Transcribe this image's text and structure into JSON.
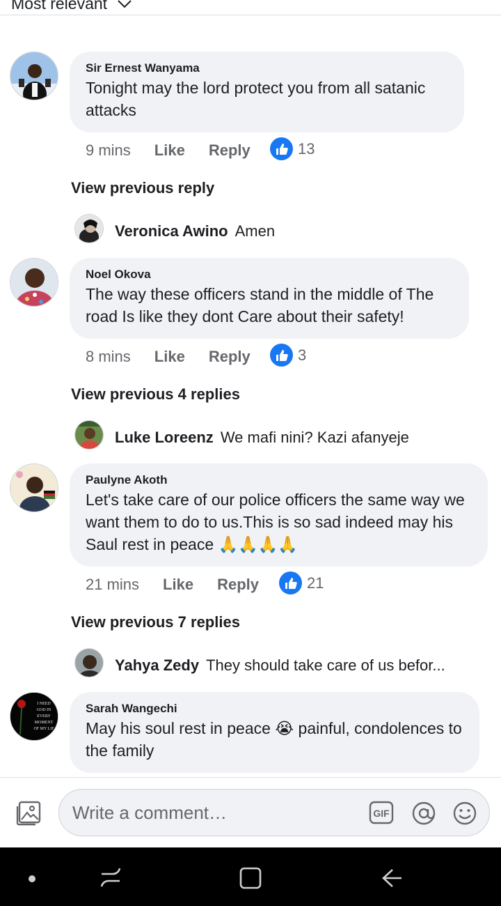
{
  "sort": {
    "label": "Most relevant"
  },
  "comments": [
    {
      "author": "Sir Ernest Wanyama",
      "text": "Tonight may the lord protect you from all satanic attacks",
      "time": "9 mins",
      "like_label": "Like",
      "reply_label": "Reply",
      "reactions": "13"
    },
    {
      "author": "Noel Okova",
      "text": "The way these officers stand in the middle of The road Is like they dont Care about their safety!",
      "time": "8 mins",
      "like_label": "Like",
      "reply_label": "Reply",
      "reactions": "3"
    },
    {
      "author": "Paulyne Akoth",
      "text": "Let's take care of our police officers the same way we want them to do to us.This is so sad indeed may his Saul rest in peace 🙏🙏🙏🙏",
      "time": "21 mins",
      "like_label": "Like",
      "reply_label": "Reply",
      "reactions": "21"
    },
    {
      "author": "Sarah Wangechi",
      "text": "May his soul rest in peace 😭 painful, condolences to the family"
    }
  ],
  "view_previous": [
    "View previous reply",
    "View previous 4 replies",
    "View previous 7 replies"
  ],
  "replies": [
    {
      "name": "Veronica Awino",
      "text": "Amen"
    },
    {
      "name": "Luke Loreenz",
      "text": "We mafi nini? Kazi afanyeje"
    },
    {
      "name": "Yahya Zedy",
      "text": "They should take care of us befor..."
    }
  ],
  "avatar_sarah_text": [
    "I NEED",
    "GOD IN",
    "EVERY",
    "MOMENT",
    "OF MY LIF"
  ],
  "composer": {
    "placeholder": "Write a comment…",
    "gif_label": "GIF"
  },
  "colors": {
    "accent": "#1877f2",
    "bubble": "#f0f2f5",
    "muted": "#65676b"
  }
}
